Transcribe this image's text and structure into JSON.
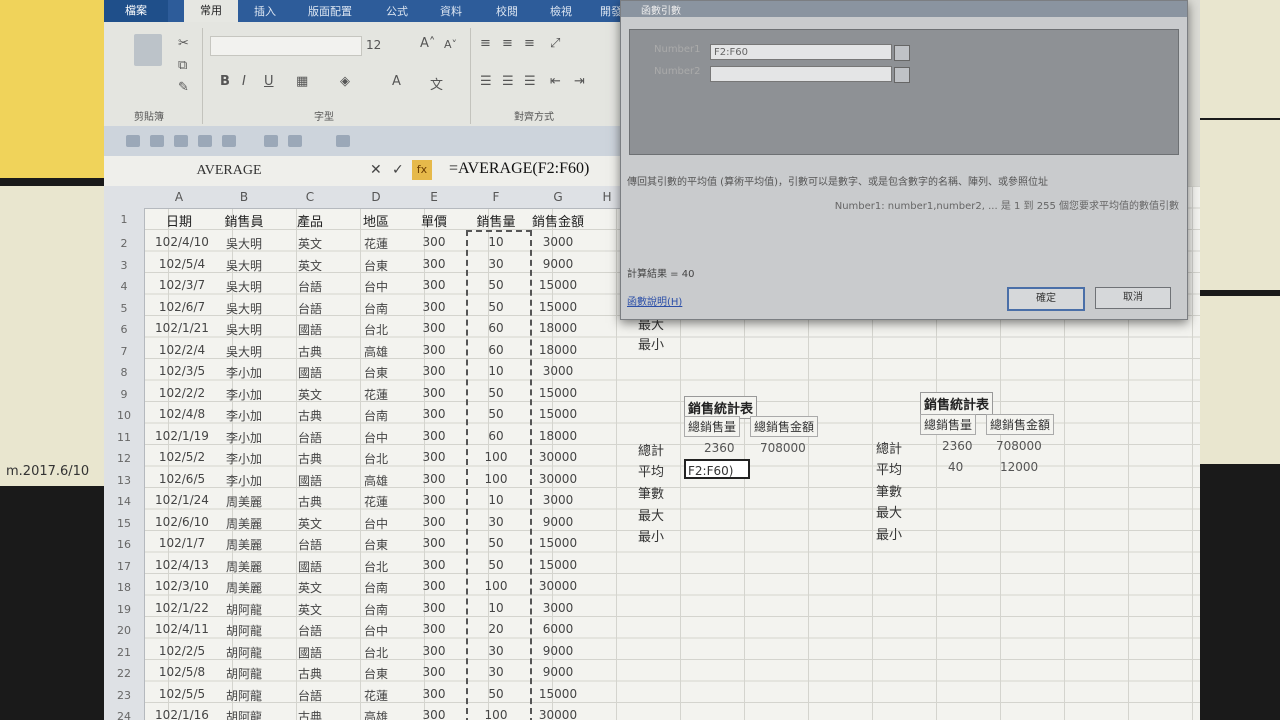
{
  "ribbon": {
    "tabs": [
      "檔案",
      "常用",
      "插入",
      "版面配置",
      "公式",
      "資料",
      "校閱",
      "檢視",
      "開發"
    ],
    "font_size": "12",
    "groups": [
      "剪貼簿",
      "字型",
      "對齊方式"
    ]
  },
  "formula_bar": {
    "name_box": "AVERAGE",
    "cancel": "✕",
    "enter": "✓",
    "fx": "fx",
    "formula": "=AVERAGE(F2:F60)"
  },
  "sheet": {
    "columns": [
      "A",
      "B",
      "C",
      "D",
      "E",
      "F",
      "G",
      "H"
    ],
    "headers": [
      "日期",
      "銷售員",
      "產品",
      "地區",
      "單價",
      "銷售量",
      "銷售金額"
    ],
    "rows": [
      [
        "102/4/10",
        "吳大明",
        "英文",
        "花蓮",
        "300",
        "10",
        "3000"
      ],
      [
        "102/5/4",
        "吳大明",
        "英文",
        "台東",
        "300",
        "30",
        "9000"
      ],
      [
        "102/3/7",
        "吳大明",
        "台語",
        "台中",
        "300",
        "50",
        "15000"
      ],
      [
        "102/6/7",
        "吳大明",
        "台語",
        "台南",
        "300",
        "50",
        "15000"
      ],
      [
        "102/1/21",
        "吳大明",
        "國語",
        "台北",
        "300",
        "60",
        "18000"
      ],
      [
        "102/2/4",
        "吳大明",
        "古典",
        "高雄",
        "300",
        "60",
        "18000"
      ],
      [
        "102/3/5",
        "李小加",
        "國語",
        "台東",
        "300",
        "10",
        "3000"
      ],
      [
        "102/2/2",
        "李小加",
        "英文",
        "花蓮",
        "300",
        "50",
        "15000"
      ],
      [
        "102/4/8",
        "李小加",
        "古典",
        "台南",
        "300",
        "50",
        "15000"
      ],
      [
        "102/1/19",
        "李小加",
        "台語",
        "台中",
        "300",
        "60",
        "18000"
      ],
      [
        "102/5/2",
        "李小加",
        "古典",
        "台北",
        "300",
        "100",
        "30000"
      ],
      [
        "102/6/5",
        "李小加",
        "國語",
        "高雄",
        "300",
        "100",
        "30000"
      ],
      [
        "102/1/24",
        "周美麗",
        "古典",
        "花蓮",
        "300",
        "10",
        "3000"
      ],
      [
        "102/6/10",
        "周美麗",
        "英文",
        "台中",
        "300",
        "30",
        "9000"
      ],
      [
        "102/1/7",
        "周美麗",
        "台語",
        "台東",
        "300",
        "50",
        "15000"
      ],
      [
        "102/4/13",
        "周美麗",
        "國語",
        "台北",
        "300",
        "50",
        "15000"
      ],
      [
        "102/3/10",
        "周美麗",
        "英文",
        "台南",
        "300",
        "100",
        "30000"
      ],
      [
        "102/1/22",
        "胡阿龍",
        "英文",
        "台南",
        "300",
        "10",
        "3000"
      ],
      [
        "102/4/11",
        "胡阿龍",
        "台語",
        "台中",
        "300",
        "20",
        "6000"
      ],
      [
        "102/2/5",
        "胡阿龍",
        "國語",
        "台北",
        "300",
        "30",
        "9000"
      ],
      [
        "102/5/8",
        "胡阿龍",
        "古典",
        "台東",
        "300",
        "30",
        "9000"
      ],
      [
        "102/5/5",
        "胡阿龍",
        "台語",
        "花蓮",
        "300",
        "50",
        "15000"
      ],
      [
        "102/1/16",
        "胡阿龍",
        "古典",
        "高雄",
        "300",
        "100",
        "30000"
      ]
    ],
    "stats_left": {
      "partial_labels": [
        "最大",
        "最小"
      ],
      "title": "銷售統計表",
      "col1": "總銷售量",
      "col2": "總銷售金額",
      "labels": [
        "總計",
        "平均",
        "筆數",
        "最大",
        "最小"
      ],
      "total_qty": "2360",
      "total_amount": "708000",
      "active_cell": "F2:F60)"
    },
    "stats_right": {
      "title": "銷售統計表",
      "col1": "總銷售量",
      "col2": "總銷售金額",
      "labels": [
        "總計",
        "平均",
        "筆數",
        "最大",
        "最小"
      ],
      "total_qty": "2360",
      "total_amount": "708000",
      "avg_qty": "40",
      "avg_amount": "12000"
    }
  },
  "dialog": {
    "title": "函數引數",
    "number1_label": "Number1",
    "number1_value": "F2:F60",
    "number2_label": "Number2",
    "description": "傳回其引數的平均值 (算術平均值)，引數可以是數字、或是包含數字的名稱、陣列、或參照位址",
    "help": "Number1: number1,number2, ... 是 1 到 255 個您要求平均值的數值引數",
    "result": "計算結果 = 40",
    "link": "函數說明(H)",
    "ok": "確定",
    "cancel": "取消"
  },
  "notes": {
    "left_bottom": "m.2017.6/10"
  }
}
